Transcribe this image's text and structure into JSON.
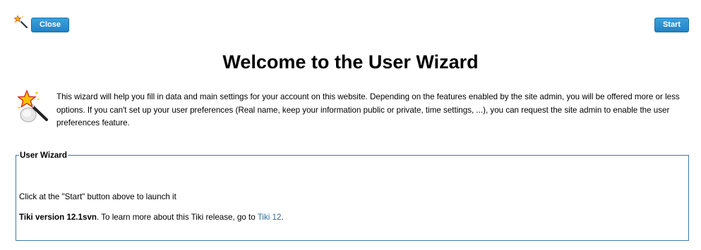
{
  "toolbar": {
    "wand_icon": "magic-wand-icon",
    "close_label": "Close",
    "start_label": "Start",
    "button_color": "#2388cc"
  },
  "page": {
    "title": "Welcome to the User Wizard",
    "intro_icon": "magic-wand-icon",
    "intro_text": "This wizard will help you fill in data and main settings for your account on this website. Depending on the features enabled by the site admin, you will be offered more or less options. If you can't set up your user preferences (Real name, keep your information public or private, time settings, ...), you can request the site admin to enable the user preferences feature."
  },
  "fieldset": {
    "legend": "User Wizard",
    "instruction": "Click at the \"Start\" button above to launch it",
    "version_label": "Tiki version 12.1svn",
    "version_suffix": ". To learn more about this Tiki release, go to ",
    "link_text": "Tiki 12",
    "trailing": ".",
    "link_color": "#2a6fa9",
    "border_color": "#3f7aa5"
  }
}
